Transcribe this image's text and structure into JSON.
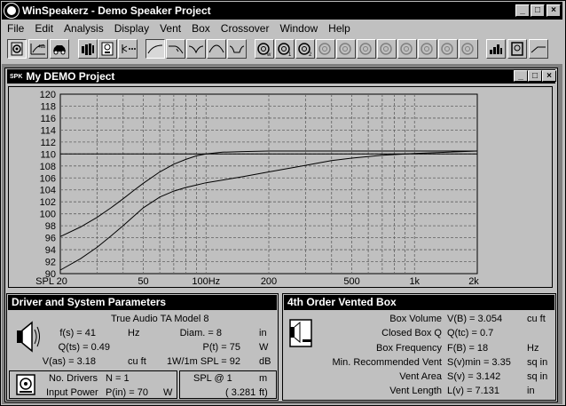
{
  "window": {
    "title": "WinSpeakerz - Demo Speaker Project"
  },
  "menu": [
    "File",
    "Edit",
    "Analysis",
    "Display",
    "Vent",
    "Box",
    "Crossover",
    "Window",
    "Help"
  ],
  "child_window": {
    "title": "My DEMO Project",
    "icon_text": "SPK"
  },
  "chart_data": {
    "type": "line",
    "x_scale": "log",
    "xlim": [
      20,
      2000
    ],
    "ylim": [
      90,
      120
    ],
    "y_ticks": [
      90,
      92,
      94,
      96,
      98,
      100,
      102,
      104,
      106,
      108,
      110,
      112,
      114,
      116,
      118,
      120
    ],
    "x_tick_labels": [
      {
        "x": 20,
        "label": "SPL 20"
      },
      {
        "x": 50,
        "label": "50"
      },
      {
        "x": 100,
        "label": "100Hz"
      },
      {
        "x": 200,
        "label": "200"
      },
      {
        "x": 500,
        "label": "500"
      },
      {
        "x": 1000,
        "label": "1k"
      },
      {
        "x": 2000,
        "label": "2k"
      }
    ],
    "x_gridlines": [
      20,
      30,
      40,
      50,
      60,
      70,
      80,
      90,
      100,
      200,
      300,
      400,
      500,
      600,
      700,
      800,
      900,
      1000,
      2000
    ],
    "grid": true,
    "series": [
      {
        "x": [
          20,
          25,
          30,
          35,
          40,
          45,
          50,
          60,
          70,
          80,
          90,
          100,
          120,
          150,
          200,
          300,
          500,
          1000,
          2000
        ],
        "values": [
          96.2,
          97.8,
          99.4,
          101.0,
          102.5,
          103.9,
          105.1,
          107.0,
          108.3,
          109.1,
          109.7,
          110.0,
          110.3,
          110.4,
          110.5,
          110.5,
          110.5,
          110.5,
          110.5
        ]
      },
      {
        "x": [
          20,
          25,
          30,
          35,
          40,
          45,
          50,
          60,
          70,
          80,
          90,
          100,
          150,
          200,
          300,
          400,
          500,
          700,
          1000,
          2000
        ],
        "values": [
          90.6,
          92.5,
          94.4,
          96.3,
          98.0,
          99.6,
          101.0,
          102.8,
          103.8,
          104.4,
          104.8,
          105.2,
          106.2,
          107.0,
          108.1,
          108.9,
          109.3,
          109.8,
          110.1,
          110.5
        ]
      },
      {
        "x": [
          20,
          2000
        ],
        "values": [
          110,
          110
        ]
      }
    ]
  },
  "driver_panel": {
    "title": "Driver and System Parameters",
    "model": "True Audio  TA Model 8",
    "fs_label": "f(s) = 41",
    "fs_unit": "Hz",
    "diam_label": "Diam. = 8",
    "diam_unit": "in",
    "qts_label": "Q(ts) = 0.49",
    "pt_label": "P(t) = 75",
    "pt_unit": "W",
    "vas_label": "V(as) = 3.18",
    "vas_unit": "cu ft",
    "spl_label": "1W/1m SPL = 92",
    "spl_unit": "dB",
    "no_drivers_label": "No. Drivers",
    "no_drivers_value": "N = 1",
    "input_power_label": "Input Power",
    "input_power_value": "P(in) = 70",
    "input_power_unit": "W",
    "spl_at_label": "SPL @ 1",
    "spl_at_unit": "m",
    "spl_at_ft": "( 3.281",
    "spl_at_ft_unit": "ft)"
  },
  "box_panel": {
    "title": "4th Order Vented Box",
    "rows": [
      {
        "label": "Box Volume",
        "sym": "V(B) = 3.054",
        "unit": "cu ft"
      },
      {
        "label": "Closed Box Q",
        "sym": "Q(tc) = 0.7",
        "unit": ""
      },
      {
        "label": "Box Frequency",
        "sym": "F(B) = 18",
        "unit": "Hz"
      },
      {
        "label": "Min. Recommended Vent",
        "sym": "S(v)min = 3.35",
        "unit": "sq in"
      },
      {
        "label": "Vent Area",
        "sym": "S(v) = 3.142",
        "unit": "sq in"
      },
      {
        "label": "Vent Length",
        "sym": "L(v) = 7.131",
        "unit": "in"
      }
    ]
  }
}
